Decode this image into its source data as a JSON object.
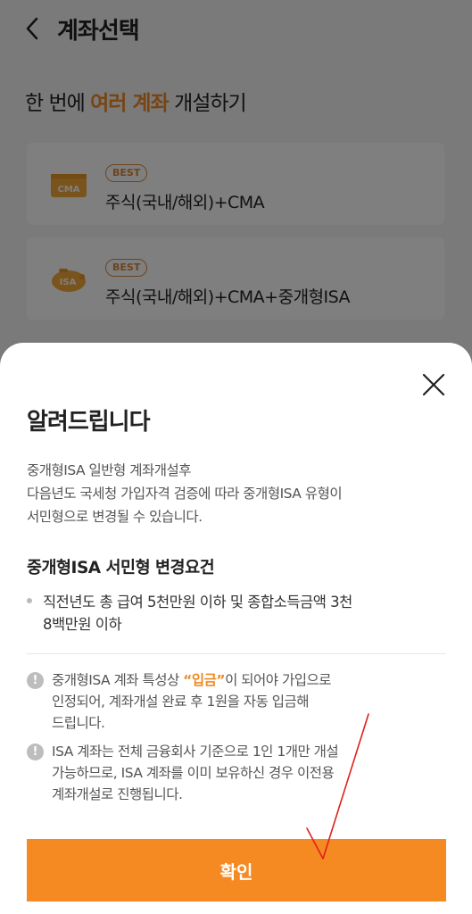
{
  "header": {
    "title": "계좌선택",
    "back_icon": "chevron-left-icon"
  },
  "headline": {
    "prefix": "한 번에 ",
    "highlight": "여러 계좌",
    "suffix": " 개설하기"
  },
  "accounts": [
    {
      "badge": "BEST",
      "name": "주식(국내/해외)+CMA",
      "icon": "cma-card-icon",
      "icon_text": "CMA"
    },
    {
      "badge": "BEST",
      "name": "주식(국내/해외)+CMA+중개형ISA",
      "icon": "isa-piggybank-icon",
      "icon_text": "ISA"
    }
  ],
  "modal": {
    "title": "알려드립니다",
    "description": [
      "중개형ISA 일반형 계좌개설후",
      "다음년도 국세청 가입자격 검증에 따라 중개형ISA 유형이",
      "서민형으로 변경될 수 있습니다."
    ],
    "subheading": "중개형ISA 서민형 변경요건",
    "requirement": {
      "line1": "직전년도 총 급여 5천만원 이하 및 종합소득금액 3천",
      "line2": "8백만원 이하"
    },
    "notes": [
      {
        "before": "중개형ISA 계좌 특성상 ",
        "emphasis": "“입금”",
        "after": "이 되어야 가입으로",
        "line2": "인정되어, 계좌개설 완료 후 1원을 자동 입금해",
        "line3": "드립니다."
      },
      {
        "line1": "ISA 계좌는 전체 금융회사 기준으로 1인 1개만 개설",
        "line2": "가능하므로, ISA 계좌를 이미 보유하신 경우 이전용",
        "line3": "계좌개설로 진행됩니다."
      }
    ],
    "warn_glyph": "!",
    "confirm_label": "확인",
    "close_icon": "close-icon"
  },
  "colors": {
    "accent": "#f58a23",
    "badge": "#d9893a",
    "annotation": "#e0201c"
  }
}
